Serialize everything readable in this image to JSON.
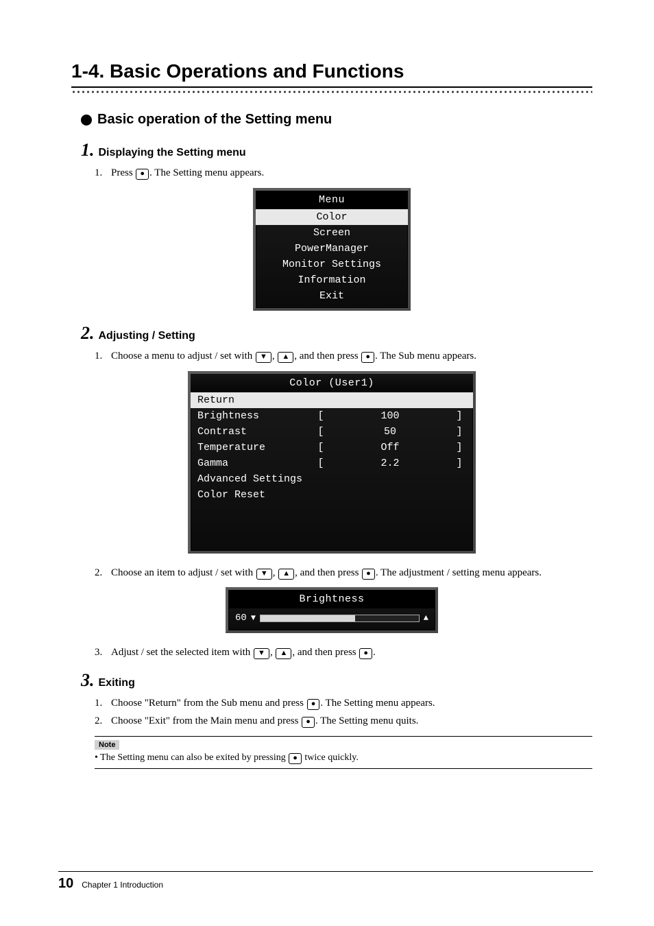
{
  "section": {
    "title": "1-4.  Basic Operations and Functions"
  },
  "subheading": "Basic operation of the Setting menu",
  "step1": {
    "num": "1.",
    "title": "Displaying the Setting menu",
    "item1_num": "1.",
    "item1_before": "Press ",
    "item1_after": ". The Setting menu appears."
  },
  "osd_menu": {
    "title": "Menu",
    "selected": "Color",
    "items": [
      "Screen",
      "PowerManager",
      "Monitor Settings",
      "Information",
      "Exit"
    ]
  },
  "step2": {
    "num": "2.",
    "title": "Adjusting / Setting",
    "item1_num": "1.",
    "item1_a": "Choose a menu to adjust / set with ",
    "item1_b": ", ",
    "item1_c": ", and then press ",
    "item1_d": ". The Sub menu appears.",
    "item2_num": "2.",
    "item2_a": "Choose an item to adjust / set with ",
    "item2_b": ", ",
    "item2_c": ", and then press ",
    "item2_d": ". The adjustment / setting menu appears.",
    "item3_num": "3.",
    "item3_a": "Adjust / set the selected item with ",
    "item3_b": ", ",
    "item3_c": ", and then press ",
    "item3_d": "."
  },
  "chart_data": {
    "type": "table",
    "title": "Color (User1)",
    "selected": "Return",
    "rows": [
      {
        "label": "Brightness",
        "value": "100"
      },
      {
        "label": "Contrast",
        "value": "50"
      },
      {
        "label": "Temperature",
        "value": "Off"
      },
      {
        "label": "Gamma",
        "value": "2.2"
      }
    ],
    "simple_rows": [
      "Advanced Settings",
      "Color Reset"
    ]
  },
  "osd_slider": {
    "title": "Brightness",
    "value": "60",
    "percent": 60
  },
  "step3": {
    "num": "3.",
    "title": "Exiting",
    "item1_num": "1.",
    "item1_a": "Choose \"Return\" from the Sub menu and press ",
    "item1_b": ". The Setting menu appears.",
    "item2_num": "2.",
    "item2_a": "Choose \"Exit\" from the Main menu and press ",
    "item2_b": ". The Setting menu quits."
  },
  "note": {
    "label": "Note",
    "bullet": "•",
    "text_a": "The Setting menu can also be exited by pressing ",
    "text_b": " twice quickly."
  },
  "footer": {
    "page": "10",
    "chapter": "Chapter 1 Introduction"
  },
  "icons": {
    "enter": "●",
    "down": "▼",
    "up": "▲"
  }
}
